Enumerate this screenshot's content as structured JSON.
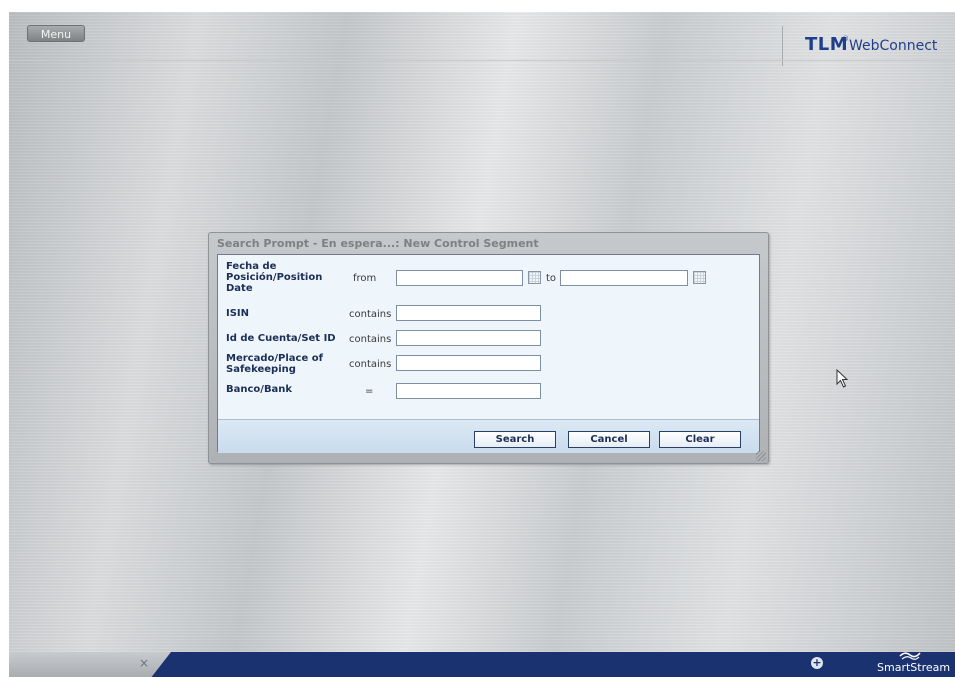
{
  "header": {
    "menu_label": "Menu",
    "brand_primary": "TLM",
    "brand_mark": "®",
    "brand_secondary": "WebConnect"
  },
  "dialog": {
    "title": "Search Prompt - En espera...: New Control Segment",
    "fields": [
      {
        "label": "Fecha de Posición/Position Date",
        "operator": "from",
        "range_separator": "to",
        "value_from": "",
        "value_to": ""
      },
      {
        "label": "ISIN",
        "operator": "contains",
        "value": ""
      },
      {
        "label": "Id de Cuenta/Set ID",
        "operator": "contains",
        "value": ""
      },
      {
        "label": "Mercado/Place of Safekeeping",
        "operator": "contains",
        "value": ""
      },
      {
        "label": "Banco/Bank",
        "operator": "=",
        "value": ""
      }
    ],
    "buttons": {
      "search": "Search",
      "cancel": "Cancel",
      "clear": "Clear"
    }
  },
  "footer": {
    "close_glyph": "×",
    "add_glyph": "+",
    "logo_text": "SmartStream"
  },
  "colors": {
    "frame_navy": "#1d3473",
    "label_navy": "#1d2f57",
    "brand_blue": "#1f3f8c",
    "dialog_body": "#eef5fb"
  }
}
